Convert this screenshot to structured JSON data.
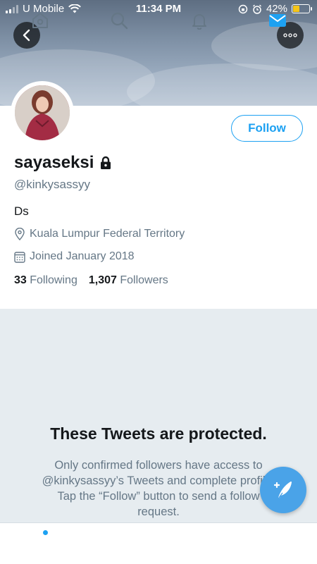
{
  "status_bar": {
    "carrier": "U Mobile",
    "time": "11:34 PM",
    "battery": "42%",
    "battery_level": 0.42
  },
  "profile": {
    "display_name": "sayaseksi",
    "handle": "@kinkysassyy",
    "bio": "Ds",
    "location": "Kuala Lumpur Federal Territory",
    "joined": "Joined January 2018",
    "following_count": "33",
    "following_label": "Following",
    "followers_count": "1,307",
    "followers_label": "Followers",
    "follow_label": "Follow",
    "locked": true
  },
  "protected": {
    "title": "These Tweets are protected.",
    "body": "Only confirmed followers have access to @kinkysassyy’s Tweets and complete profile. Tap the “Follow” button to send a follow request."
  },
  "tabbar": {
    "items": [
      "home-icon",
      "search-icon",
      "notifications-icon",
      "messages-icon"
    ],
    "active": "messages-icon"
  },
  "colors": {
    "accent": "#1da1f2",
    "fab": "#4aa3e8",
    "background": "#e6ecf0",
    "muted": "#657786"
  }
}
